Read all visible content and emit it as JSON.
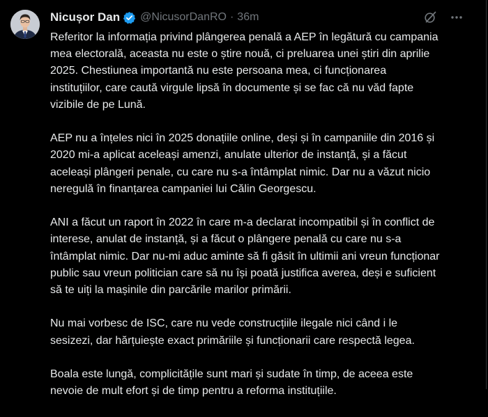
{
  "author": {
    "display_name": "Nicușor Dan",
    "handle": "@NicusorDanRO",
    "separator": "·",
    "time": "36m",
    "avatar_icon": "portrait-avatar",
    "verified_icon": "verified-badge-icon"
  },
  "colors": {
    "background": "#000000",
    "text": "#e7e9ea",
    "muted": "#71767b",
    "verified_blue": "#1d9bf0"
  },
  "actions": {
    "grok_icon": "grok-icon",
    "more_icon": "more-options-icon"
  },
  "paragraphs": [
    "Referitor la informația privind plângerea penală a AEP în legătură cu campania mea electorală, aceasta nu este o știre nouă, ci preluarea unei știri din aprilie 2025. Chestiunea importantă nu este persoana mea, ci funcționarea instituțiilor, care caută virgule lipsă în documente și se fac că nu văd fapte vizibile de pe Lună.",
    "AEP nu a înțeles nici în 2025 donațiile online, deși și în campaniile din 2016 și 2020 mi-a aplicat aceleași amenzi, anulate ulterior de instanță, și a făcut aceleași plângeri penale, cu care nu s-a întâmplat nimic. Dar nu a văzut nicio neregulă în finanțarea campaniei lui Călin Georgescu.",
    "ANI a făcut un raport în 2022 în care m-a declarat incompatibil și în conflict de interese, anulat de instanță, și a făcut o plângere penală cu care nu s-a întâmplat nimic. Dar nu-mi aduc aminte să fi găsit în ultimii ani vreun funcționar public sau vreun politician care să nu își poată justifica averea, deși e suficient să te uiți la mașinile din parcările marilor primării.",
    "Nu mai vorbesc de ISC, care nu vede construcțiile ilegale nici când i le sesizezi, dar hărțuiește exact primăriile și funcționarii care respectă legea.",
    "Boala este lungă, complicitățile sunt mari și sudate în timp, de aceea este nevoie de mult efort și de timp pentru a reforma instituțiile."
  ]
}
